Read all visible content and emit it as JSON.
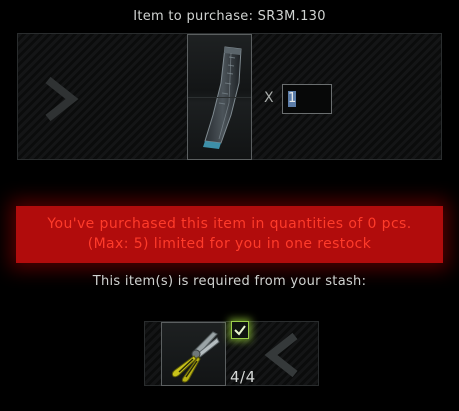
{
  "header": {
    "title": "Item to purchase: SR3M.130"
  },
  "purchase": {
    "multiplier_symbol": "X",
    "quantity_value": "1",
    "item_icon": "magazine-icon"
  },
  "warning": {
    "line1": "You've purchased this item in quantities of 0 pcs.",
    "line2": "(Max: 5) limited for you in one restock",
    "color": "#b10c0c"
  },
  "requirements": {
    "label": "This item(s) is required from your stash:",
    "items": [
      {
        "icon": "pliers-icon",
        "count": "4/4",
        "checked": true
      }
    ]
  },
  "colors": {
    "check_accent": "#9acd4a",
    "warning_text": "#ff3b2a"
  }
}
